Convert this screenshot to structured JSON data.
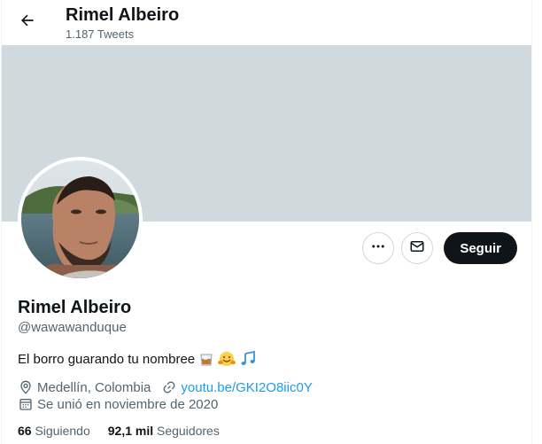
{
  "header": {
    "name": "Rimel Albeiro",
    "tweet_count": "1.187 Tweets"
  },
  "profile": {
    "display_name": "Rimel Albeiro",
    "handle": "@wawawanduque",
    "bio": "El borro guarando tu nombree",
    "location": "Medellín, Colombia",
    "website": "youtu.be/GKI2O8iic0Y",
    "joined": "Se unió en noviembre de 2020"
  },
  "stats": {
    "following_count": "66",
    "following_label": "Siguiendo",
    "followers_count": "92,1 mil",
    "followers_label": "Seguidores"
  },
  "actions": {
    "follow_label": "Seguir"
  },
  "icons": {
    "back": "arrow-left-icon",
    "more": "more-dots-icon",
    "message": "envelope-icon",
    "location": "location-pin-icon",
    "link": "link-icon",
    "calendar": "calendar-icon",
    "bio_emojis": [
      "whisky-glass-emoji",
      "hugging-face-emoji",
      "music-notes-emoji"
    ]
  },
  "colors": {
    "banner": "#cfd9de",
    "accent_link": "#1d9bf0",
    "follow_button": "#0f1419",
    "secondary_text": "#536471"
  }
}
